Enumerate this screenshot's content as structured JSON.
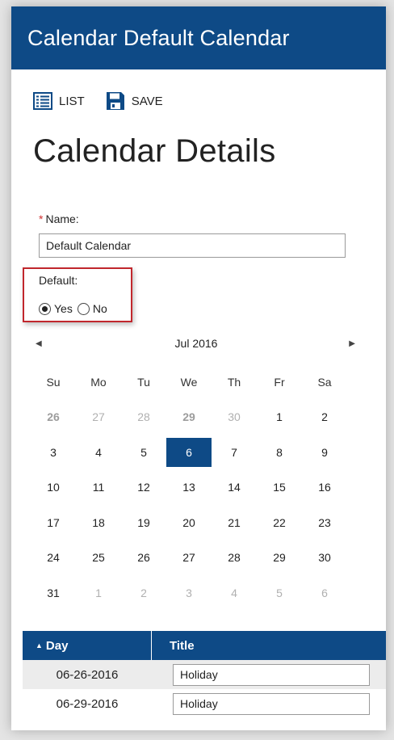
{
  "header": {
    "title": "Calendar Default Calendar"
  },
  "toolbar": {
    "list_label": "LIST",
    "save_label": "SAVE"
  },
  "page_title": "Calendar Details",
  "form": {
    "name_required_mark": "*",
    "name_label": "Name:",
    "name_value": "Default Calendar",
    "default_label": "Default:",
    "yes_label": "Yes",
    "no_label": "No",
    "default_selected": "Yes"
  },
  "calendar": {
    "month_label": "Jul 2016",
    "prev_icon": "◀",
    "next_icon": "▶",
    "weekdays": [
      "Su",
      "Mo",
      "Tu",
      "We",
      "Th",
      "Fr",
      "Sa"
    ],
    "weeks": [
      [
        "26",
        "27",
        "28",
        "29",
        "30",
        "1",
        "2"
      ],
      [
        "3",
        "4",
        "5",
        "6",
        "7",
        "8",
        "9"
      ],
      [
        "10",
        "11",
        "12",
        "13",
        "14",
        "15",
        "16"
      ],
      [
        "17",
        "18",
        "19",
        "20",
        "21",
        "22",
        "23"
      ],
      [
        "24",
        "25",
        "26",
        "27",
        "28",
        "29",
        "30"
      ],
      [
        "31",
        "1",
        "2",
        "3",
        "4",
        "5",
        "6"
      ]
    ],
    "selected_date": "6",
    "highlighted_dates": [
      "26",
      "29"
    ]
  },
  "table": {
    "sort_icon": "▲",
    "headers": {
      "day": "Day",
      "title": "Title"
    },
    "rows": [
      {
        "day": "06-26-2016",
        "title": "Holiday"
      },
      {
        "day": "06-29-2016",
        "title": "Holiday"
      }
    ]
  },
  "colors": {
    "brand": "#0e4a86",
    "highlight_border": "#c1272d",
    "required": "#d03030"
  }
}
